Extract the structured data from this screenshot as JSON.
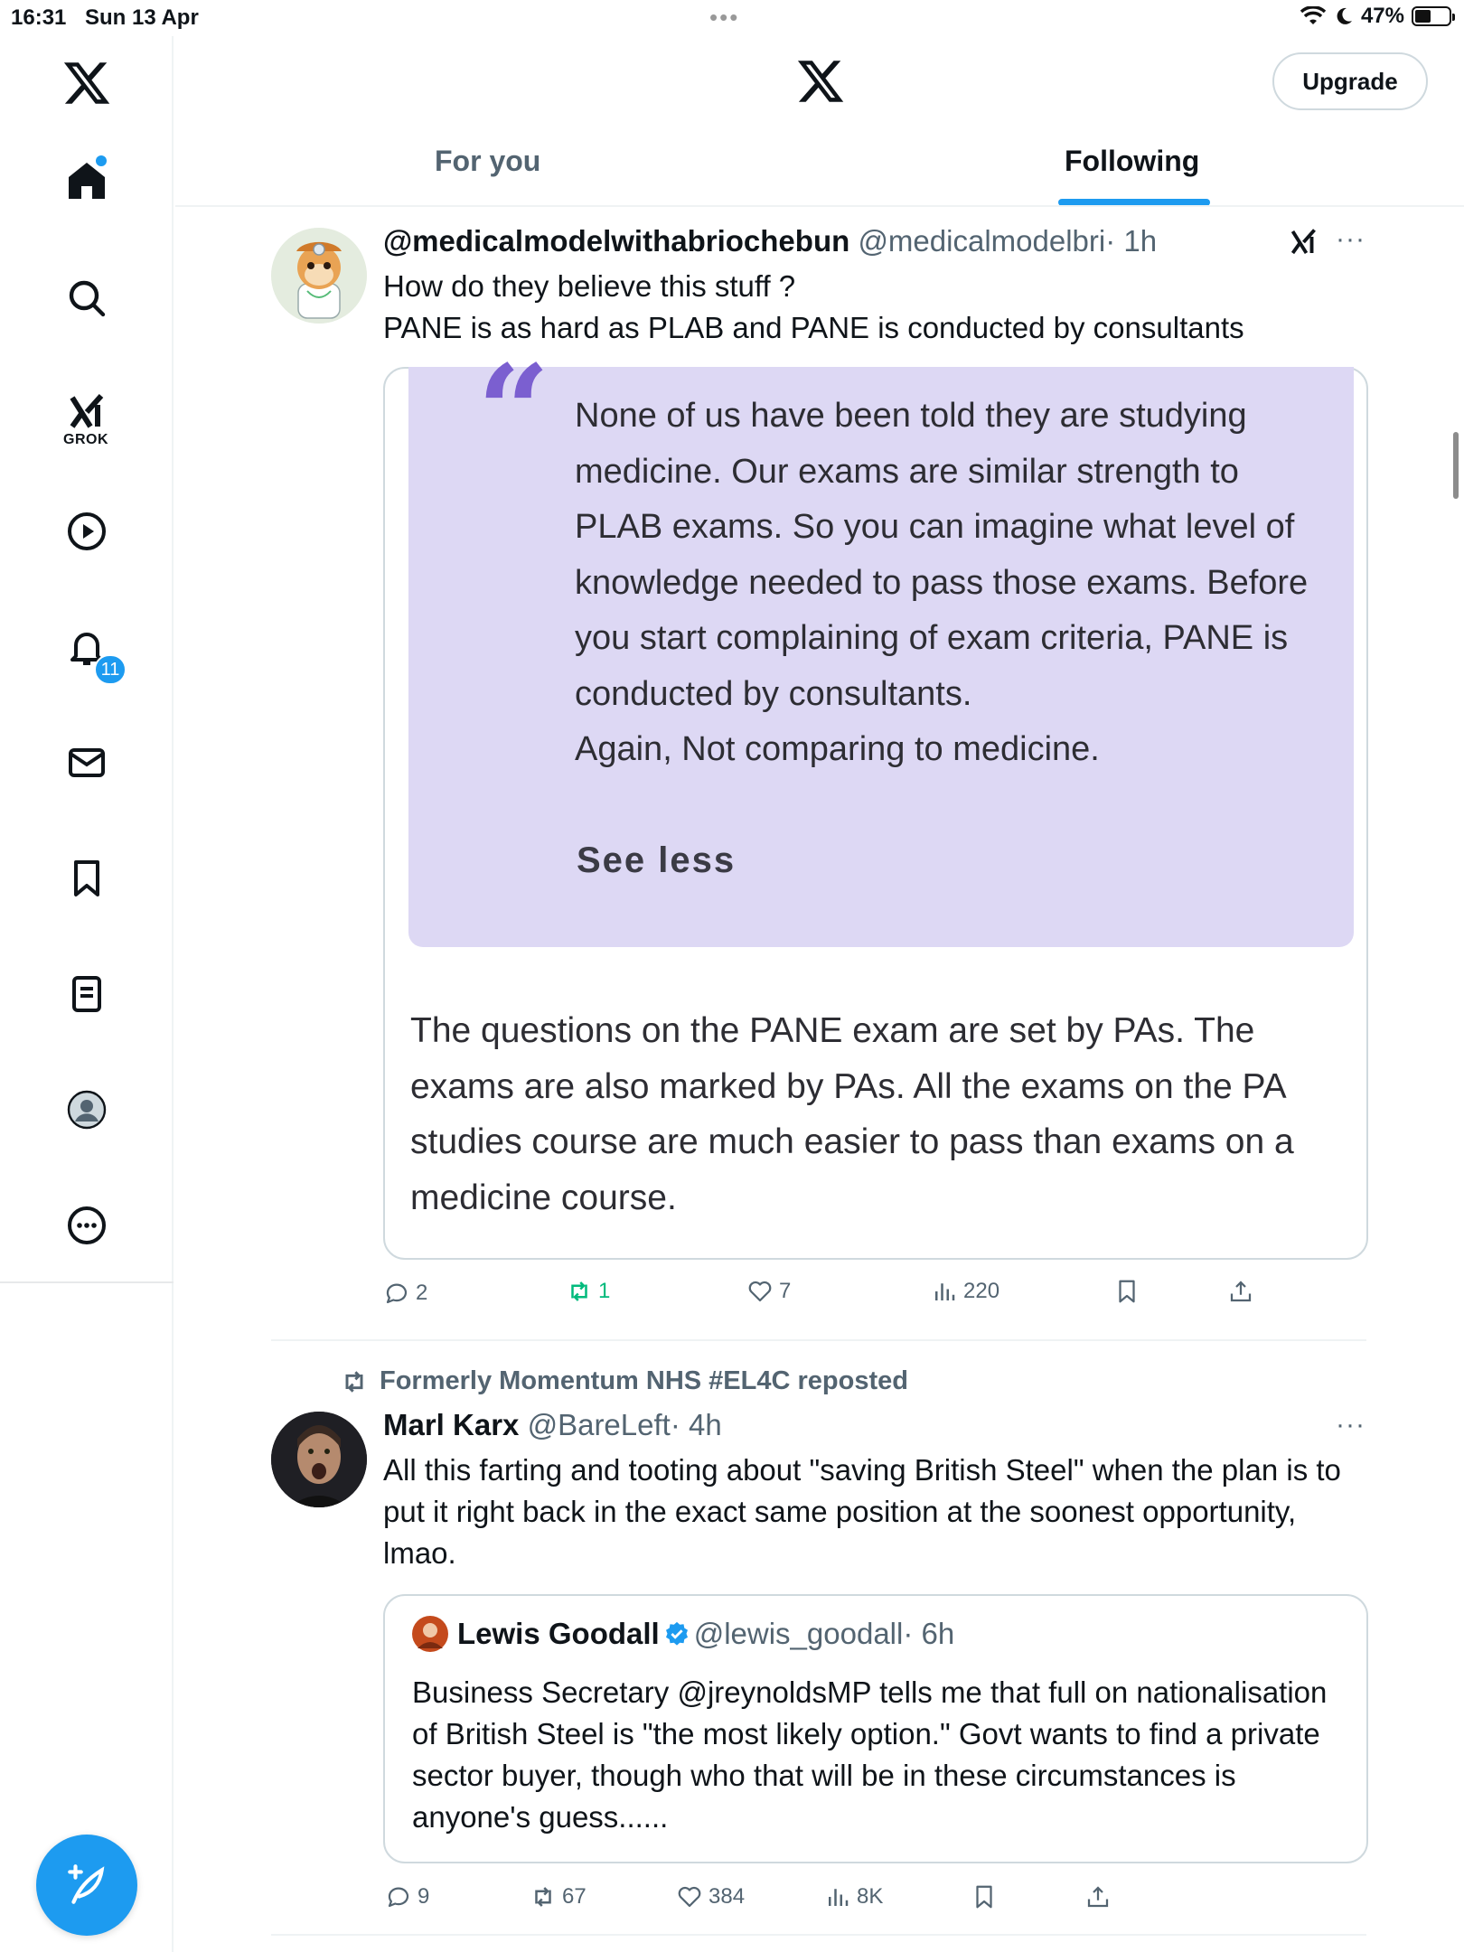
{
  "status_bar": {
    "time": "16:31",
    "date": "Sun 13 Apr",
    "battery": "47%",
    "battery_level": 0.47
  },
  "sidebar": {
    "grok_label": "GROK",
    "notifications_badge": "11",
    "items": [
      "x-logo",
      "home-icon",
      "search-icon",
      "grok-icon",
      "video-icon",
      "bell-icon",
      "mail-icon",
      "bookmark-icon",
      "lists-icon",
      "profile-icon",
      "more-icon"
    ]
  },
  "header": {
    "upgrade_label": "Upgrade",
    "tabs": [
      {
        "label": "For you",
        "active": false
      },
      {
        "label": "Following",
        "active": true
      }
    ]
  },
  "colors": {
    "accent": "#1d9bf0",
    "repost_green": "#00ba7c",
    "quote_bg": "#ddd8f4",
    "quote_mark": "#7b5fd0"
  },
  "tweets": [
    {
      "name": "@medicalmodelwithabriochebun",
      "handle": "@medicalmodelbri",
      "time": "· 1h",
      "text_lines": [
        "How do they believe this stuff ?",
        "PANE is as hard as PLAB and PANE is conducted by consultants"
      ],
      "quote_text": "None of us have been told they are studying medicine. Our exams are similar strength to PLAB exams. So you can imagine what level of knowledge needed to pass those exams. Before you start complaining of exam criteria, PANE is conducted by consultants.",
      "quote_text_2": "Again, Not comparing to medicine.",
      "see_less": "See less",
      "body_text": "The questions on the PANE exam are set by PAs. The exams are also marked by PAs. All the exams on the PA studies course are much easier to pass than exams on a medicine course.",
      "actions": {
        "replies": "2",
        "reposts": "1",
        "likes": "7",
        "views": "220"
      }
    },
    {
      "reposted_by": "Formerly Momentum NHS #EL4C reposted",
      "name": "Marl Karx",
      "handle": "@BareLeft",
      "time": "· 4h",
      "text": "All this farting and tooting about \"saving British Steel\" when the plan is to put it right back in the exact same position at the soonest opportunity, lmao.",
      "quoted": {
        "name": "Lewis Goodall",
        "handle": "@lewis_goodall",
        "time": "· 6h",
        "text": "Business Secretary @jreynoldsMP  tells me that full on nationalisation of British Steel is \"the most likely option.\" Govt wants to find a private sector buyer, though who that will be in these circumstances is anyone's guess......"
      },
      "actions": {
        "replies": "9",
        "reposts": "67",
        "likes": "384",
        "views": "8K"
      }
    }
  ]
}
